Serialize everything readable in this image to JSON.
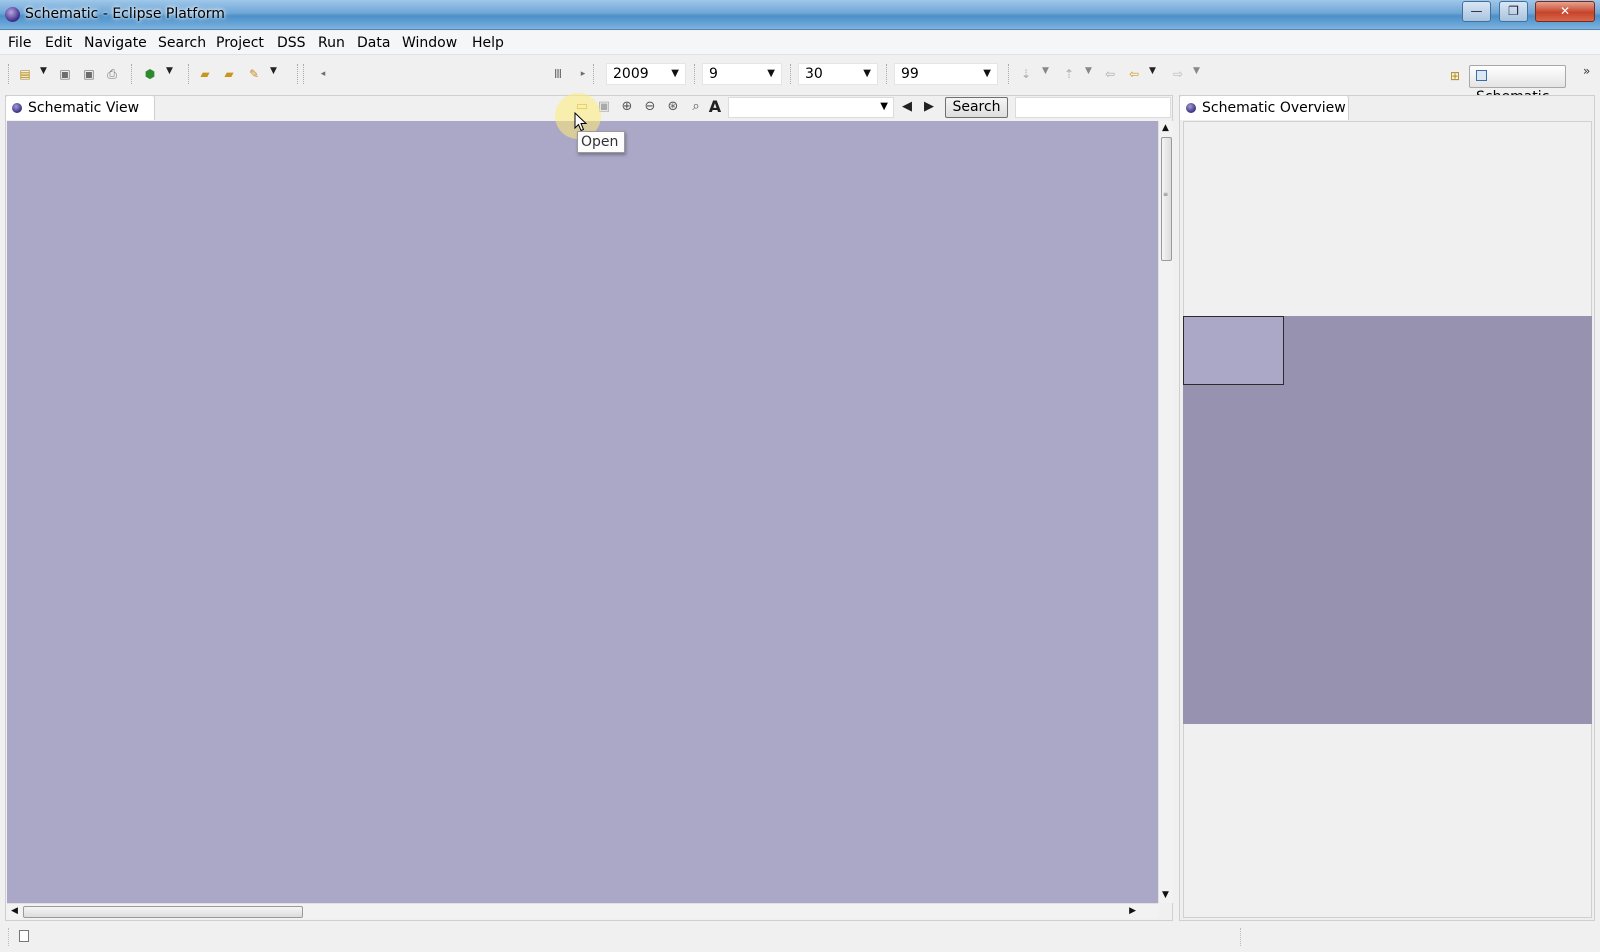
{
  "window": {
    "title": "Schematic - Eclipse Platform",
    "minimize_glyph": "—",
    "maximize_glyph": "❐",
    "close_glyph": "✕"
  },
  "menu": [
    "File",
    "Edit",
    "Navigate",
    "Search",
    "Project",
    "DSS",
    "Run",
    "Data",
    "Window",
    "Help"
  ],
  "toolbar": {
    "year": "2009",
    "month": "9",
    "day": "30",
    "value": "99",
    "perspective": "Schematic"
  },
  "views": {
    "schematic": {
      "tab_label": "Schematic View",
      "search_button": "Search",
      "search_value": "",
      "font_value": ""
    },
    "overview": {
      "tab_label": "Schematic Overview"
    }
  },
  "tooltip": "Open",
  "colors": {
    "canvas": "#aaa7c7",
    "overview_map": "#9692b0"
  },
  "icons": [
    "new-icon",
    "save-icon",
    "save-all-icon",
    "print-icon",
    "run-icon",
    "open-folder-icon",
    "open-icon",
    "wrench-icon",
    "zoom-in-icon",
    "zoom-out-icon",
    "zoom-fit-icon",
    "zoom-icon",
    "font-icon",
    "prev-icon",
    "next-icon"
  ]
}
